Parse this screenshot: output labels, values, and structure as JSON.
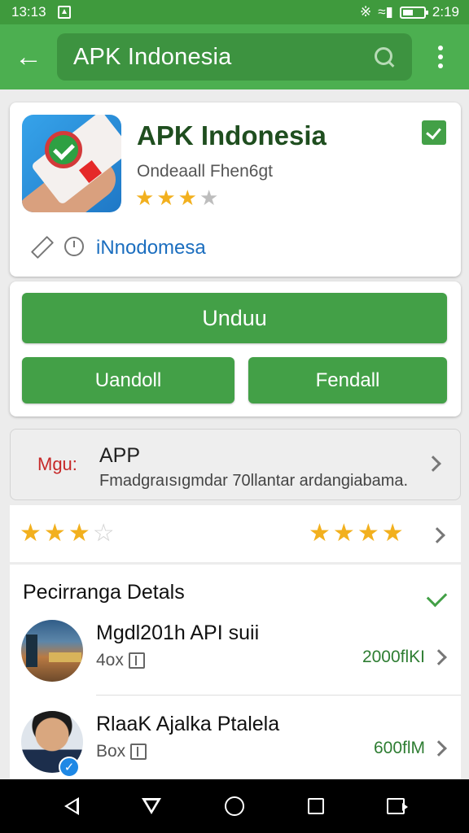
{
  "status_bar": {
    "time_left": "13:13",
    "time_right": "2:19"
  },
  "toolbar": {
    "search_text": "APK Indonesia"
  },
  "app": {
    "title": "APK Indonesia",
    "subtitle": "Ondeaall Fhen6gt",
    "rating_stars": 3,
    "publisher": "iNnodomesa"
  },
  "actions": {
    "main_label": "Unduu",
    "left_label": "Uandoll",
    "right_label": "Fendall"
  },
  "info": {
    "tag": "Mgu:",
    "title": "APP",
    "description": "Fmadgraısıgmdar 70llantar ardangiabama."
  },
  "ratings": {
    "left_stars": 3,
    "right_stars": 4
  },
  "details": {
    "title": "Pecirranga Detals",
    "items": [
      {
        "name": "Mgdl201h API suii",
        "meta": "4ox",
        "size": "2000flKI"
      },
      {
        "name": "RlaaK Ajalka Ptalela",
        "meta": "Box",
        "size": "600flM"
      }
    ]
  },
  "colors": {
    "primary": "#4caf50",
    "primary_dark": "#3f9a3d",
    "accent_green": "#43a047",
    "link_blue": "#1b6ebf",
    "tag_red": "#c62828",
    "star": "#f2b01e"
  },
  "icons": [
    "back-arrow-icon",
    "search-icon",
    "overflow-menu-icon",
    "verified-icon",
    "pencil-icon",
    "clock-icon",
    "chevron-right-icon",
    "share-icon",
    "box-icon",
    "nav-back-icon",
    "nav-down-icon",
    "nav-home-icon",
    "nav-recents-icon",
    "nav-extra-icon"
  ]
}
